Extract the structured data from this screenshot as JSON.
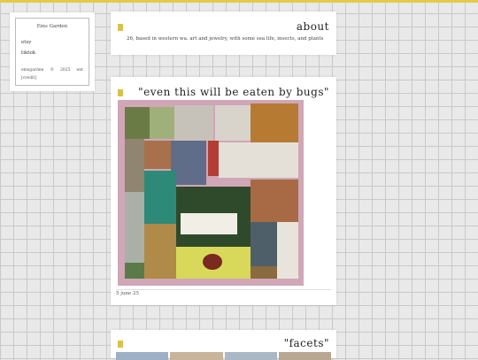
{
  "sidebar": {
    "site_title": "Ems Garden",
    "links": [
      "etsy",
      "tiktok"
    ],
    "footer": [
      "emsgarden",
      "©",
      "2025",
      "",
      "ent"
    ],
    "credit": "[credit]"
  },
  "posts": [
    {
      "title": "about",
      "body": "26, based in western wa. art and jewelry, with some sea life, insects, and plants"
    },
    {
      "title": "\"even this will be eaten by bugs\"",
      "date": "5 june 25"
    },
    {
      "title": "\"facets\""
    }
  ],
  "colors": {
    "accent": "#e6c84a",
    "marker": "#d8c24b",
    "collage_border": "#cfa7b6"
  }
}
